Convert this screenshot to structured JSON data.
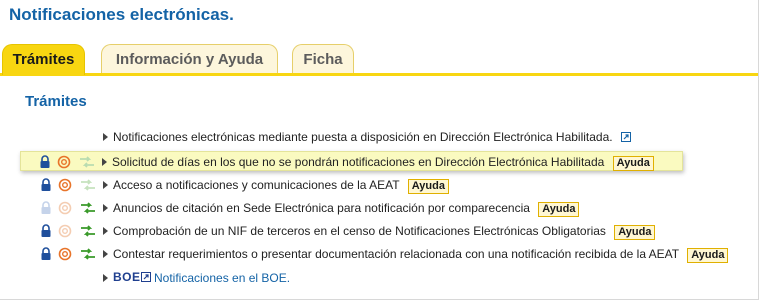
{
  "page": {
    "title": "Notificaciones electrónicas."
  },
  "tabs": [
    {
      "label": "Trámites",
      "active": true
    },
    {
      "label": "Información y Ayuda",
      "active": false
    },
    {
      "label": "Ficha",
      "active": false
    }
  ],
  "section": {
    "title": "Trámites"
  },
  "procedures": [
    {
      "label": "Notificaciones electrónicas mediante puesta a disposición en Dirección Electrónica Habilitada.",
      "icons": [
        "none",
        "none",
        "none"
      ],
      "external_link": true,
      "help": "",
      "highlighted": false
    },
    {
      "label": "Solicitud de días en los que no se pondrán notificaciones en Dirección Electrónica Habilitada",
      "icons": [
        "lock-icon",
        "certificate-icon",
        "transfer-arrows-icon-faded"
      ],
      "external_link": false,
      "help": "Ayuda",
      "highlighted": true
    },
    {
      "label": "Acceso a notificaciones y comunicaciones de la AEAT",
      "icons": [
        "lock-icon",
        "certificate-icon",
        "transfer-arrows-icon-faded"
      ],
      "external_link": false,
      "help": "Ayuda",
      "highlighted": false
    },
    {
      "label": "Anuncios de citación en Sede Electrónica para notificación por comparecencia",
      "icons": [
        "lock-icon-faded",
        "certificate-icon-faded",
        "transfer-arrows-icon"
      ],
      "external_link": false,
      "help": "Ayuda",
      "highlighted": false
    },
    {
      "label": "Comprobación de un NIF de terceros en el censo de Notificaciones Electrónicas Obligatorias",
      "icons": [
        "lock-icon",
        "certificate-icon-faded",
        "transfer-arrows-icon"
      ],
      "external_link": false,
      "help": "Ayuda",
      "highlighted": false
    },
    {
      "label": "Contestar requerimientos o presentar documentación relacionada con una notificación recibida de la AEAT",
      "icons": [
        "lock-icon",
        "certificate-icon",
        "transfer-arrows-icon"
      ],
      "external_link": false,
      "help": "Ayuda",
      "highlighted": false
    }
  ],
  "boe": {
    "logo_text": "BOE",
    "link_label": "Notificaciones en el BOE."
  },
  "colors": {
    "title_blue": "#1463a6",
    "tab_active": "#f8d611",
    "tab_inactive": "#fdf6dc",
    "highlight_row": "#fafac0",
    "lock_blue": "#1f4f9c",
    "certificate_orange": "#e8742a",
    "arrows_green": "#3a9a2a"
  }
}
